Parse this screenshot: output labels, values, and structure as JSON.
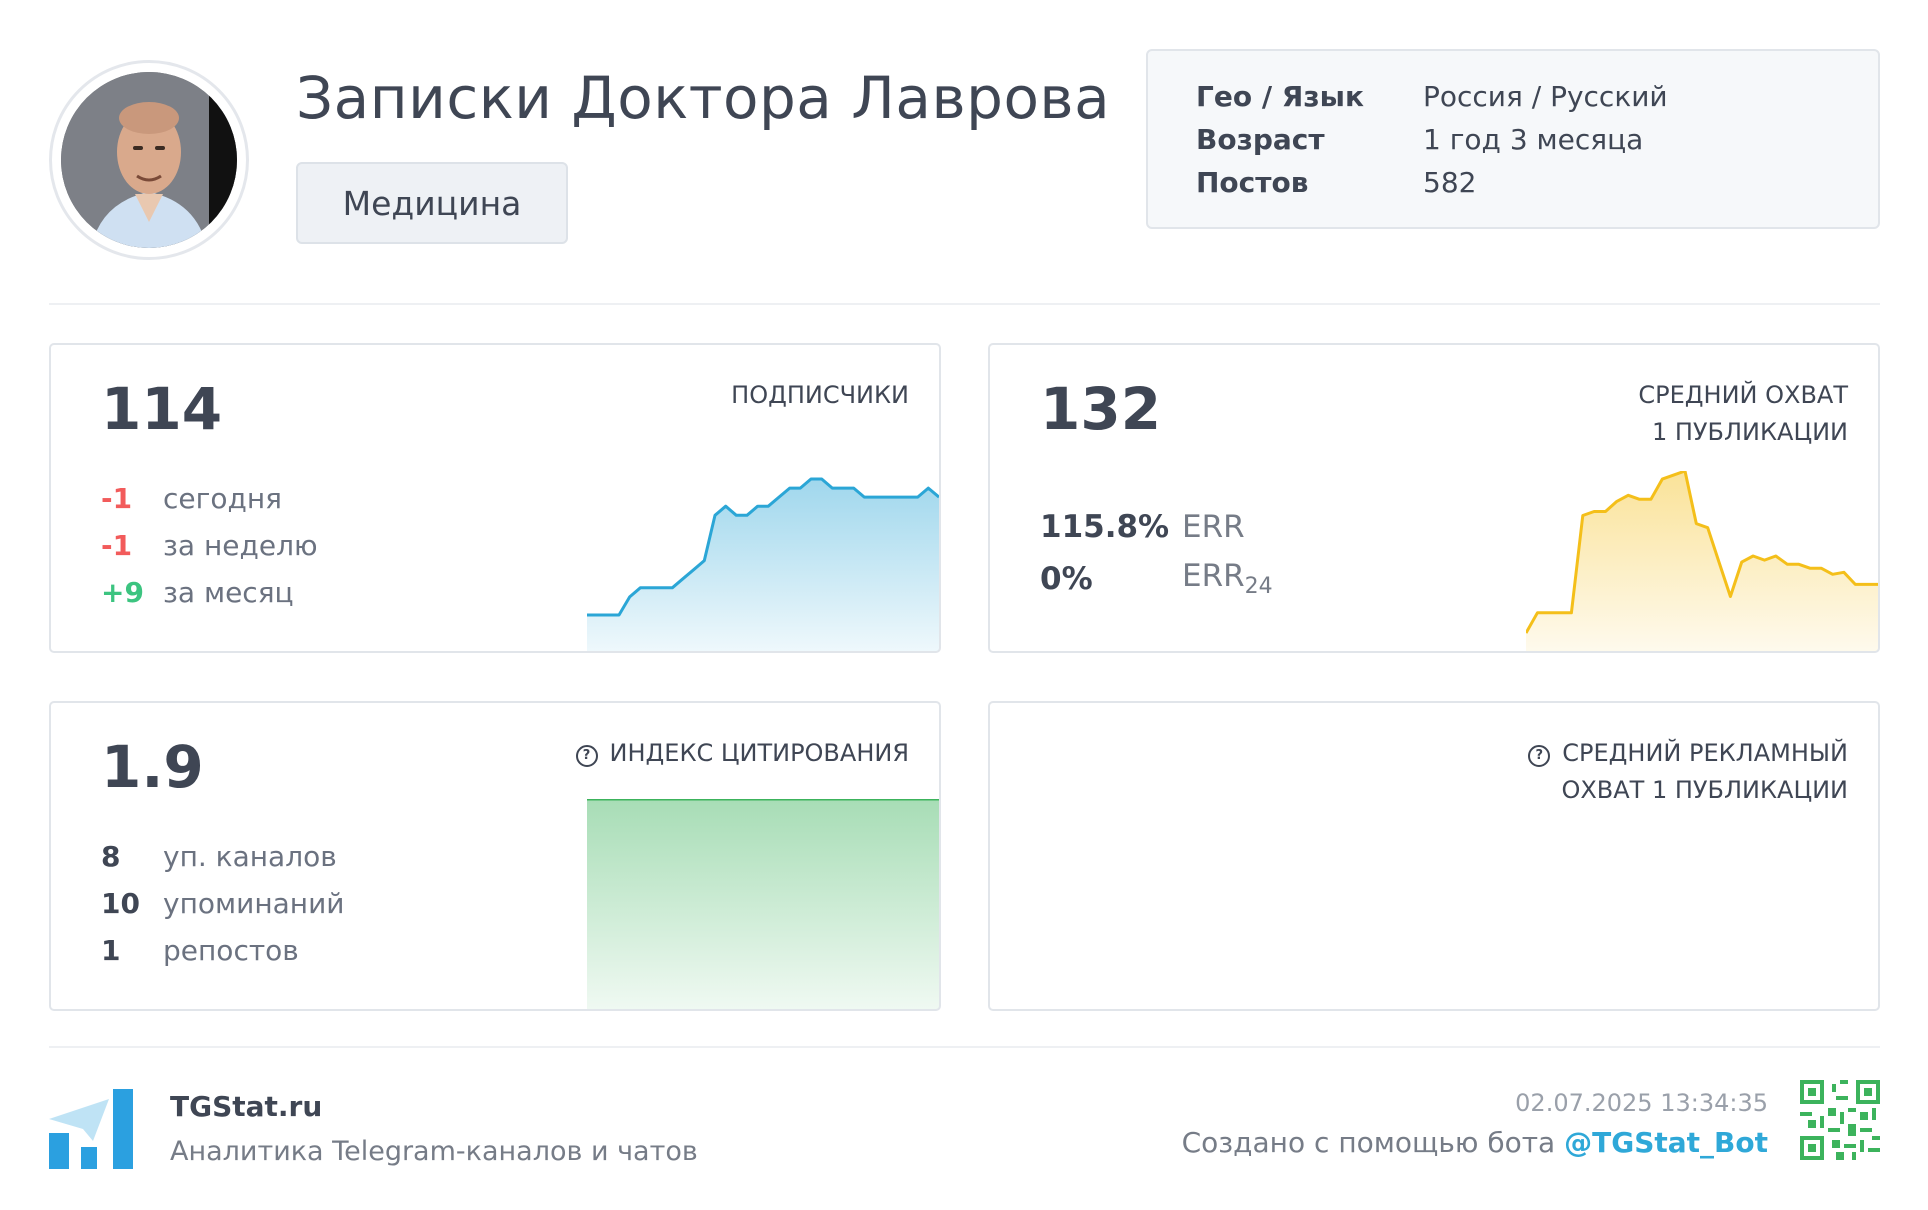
{
  "channel": {
    "title": "Записки Доктора Лаврова",
    "category": "Медицина"
  },
  "info": [
    {
      "key": "Гео / Язык",
      "value": "Россия / Русский"
    },
    {
      "key": "Возраст",
      "value": "1 год 3 месяца"
    },
    {
      "key": "Постов",
      "value": "582"
    }
  ],
  "subscribers": {
    "value": "114",
    "label": "ПОДПИСЧИКИ",
    "changes": [
      {
        "value": "-1",
        "label": "сегодня",
        "tone": "neg"
      },
      {
        "value": "-1",
        "label": "за неделю",
        "tone": "neg"
      },
      {
        "value": "+9",
        "label": "за месяц",
        "tone": "pos"
      }
    ]
  },
  "avg_reach": {
    "value": "132",
    "label": "СРЕДНИЙ ОХВАТ\n1 ПУБЛИКАЦИИ",
    "err_value": "115.8%",
    "err_label": "ERR",
    "err24_value": "0%",
    "err24_label": "ERR",
    "err24_sub": "24"
  },
  "citation": {
    "value": "1.9",
    "label": "ИНДЕКС ЦИТИРОВАНИЯ",
    "stats": [
      {
        "value": "8",
        "label": "уп. каналов"
      },
      {
        "value": "10",
        "label": "упоминаний"
      },
      {
        "value": "1",
        "label": "репостов"
      }
    ]
  },
  "ad_reach": {
    "label": "СРЕДНИЙ РЕКЛАМНЫЙ\nОХВАТ 1 ПУБЛИКАЦИИ"
  },
  "footer": {
    "brand": "TGStat.ru",
    "tagline": "Аналитика Telegram-каналов и чатов",
    "date": "02.07.2025 13:34:35",
    "created_prefix": "Создано с помощью бота ",
    "bot": "@TGStat_Bot"
  },
  "colors": {
    "subscribers_line": "#2ba6d6",
    "reach_line": "#f4bf1a",
    "citation_line": "#3cb35c",
    "brand_blue": "#2ba0e0"
  },
  "chart_data": [
    {
      "type": "area",
      "name": "subscribers",
      "values": [
        105,
        105,
        105,
        105,
        107,
        108,
        108,
        108,
        108,
        109,
        110,
        111,
        116,
        117,
        116,
        116,
        117,
        117,
        118,
        119,
        119,
        120,
        120,
        119,
        119,
        119,
        118,
        118,
        118,
        118,
        118,
        118,
        119,
        118
      ]
    },
    {
      "type": "area",
      "name": "reach",
      "values": [
        60,
        70,
        70,
        70,
        70,
        118,
        120,
        120,
        125,
        128,
        126,
        126,
        136,
        138,
        140,
        114,
        112,
        95,
        78,
        95,
        98,
        96,
        98,
        94,
        94,
        92,
        92,
        89,
        90,
        84,
        84,
        84
      ]
    },
    {
      "type": "area",
      "name": "citation",
      "values": [
        1.9,
        1.9,
        1.9,
        1.9,
        1.9,
        1.9,
        1.9,
        1.9
      ]
    }
  ]
}
